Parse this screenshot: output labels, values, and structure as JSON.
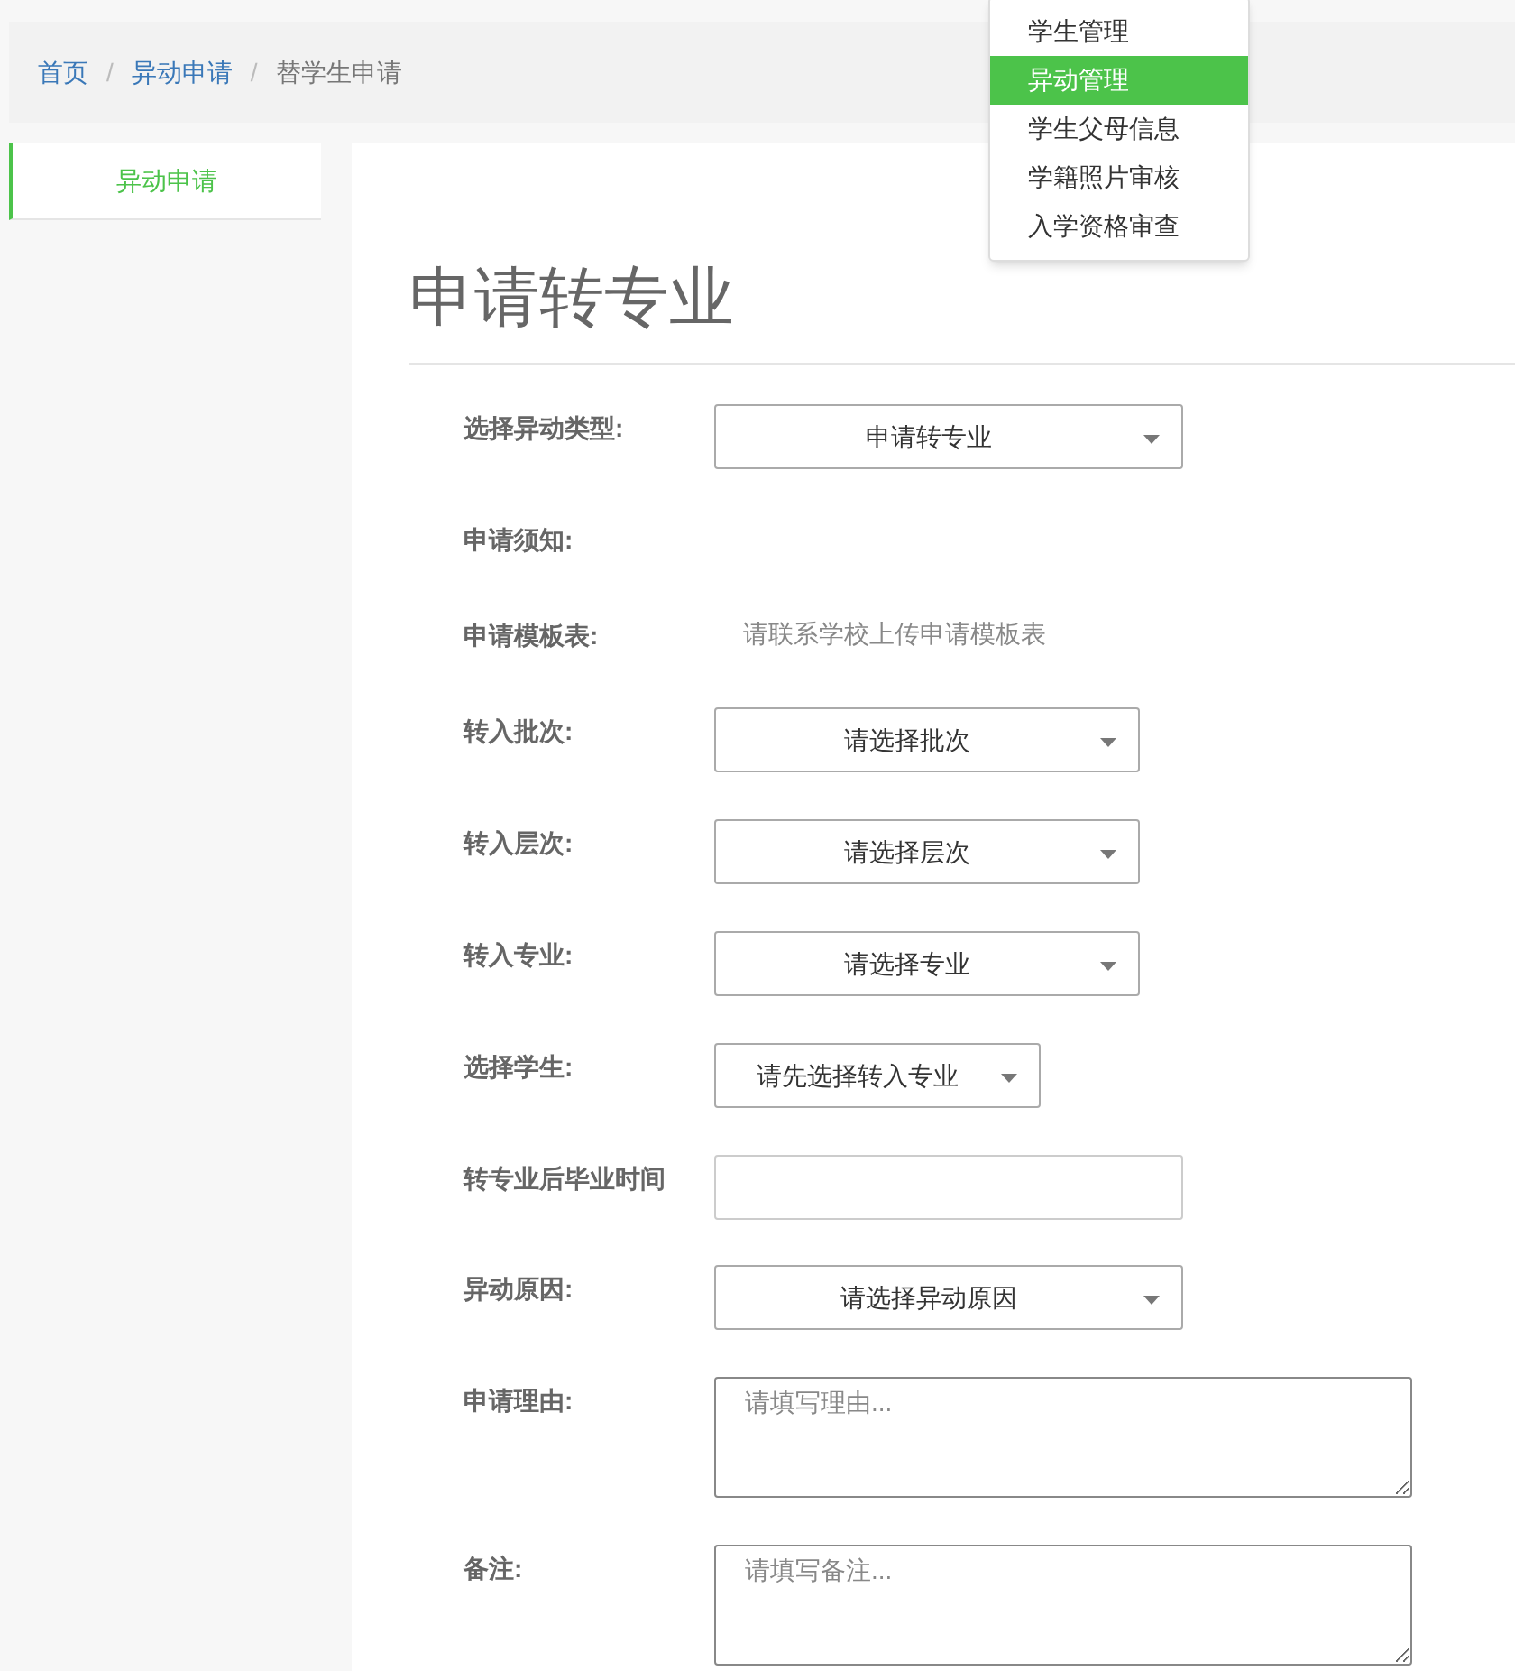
{
  "breadcrumb": [
    {
      "label": "首页",
      "link": true
    },
    {
      "label": "异动申请",
      "link": true
    },
    {
      "label": "替学生申请",
      "link": false
    }
  ],
  "breadcrumb_separator": "/",
  "sidebar": {
    "items": [
      {
        "label": "异动申请",
        "selected": true
      }
    ]
  },
  "dropdown_menu": {
    "items": [
      {
        "label": "学生管理",
        "selected": false
      },
      {
        "label": "异动管理",
        "selected": true
      },
      {
        "label": "学生父母信息",
        "selected": false
      },
      {
        "label": "学籍照片审核",
        "selected": false
      },
      {
        "label": "入学资格审查",
        "selected": false
      }
    ]
  },
  "page_title": "申请转专业",
  "form": [
    {
      "kind": "select",
      "label": "选择异动类型:",
      "value": "申请转专业"
    },
    {
      "kind": "note",
      "label": "申请须知:"
    },
    {
      "kind": "text",
      "label": "申请模板表:",
      "value": "请联系学校上传申请模板表"
    },
    {
      "kind": "select",
      "label": "转入批次:",
      "value": "请选择批次"
    },
    {
      "kind": "select",
      "label": "转入层次:",
      "value": "请选择层次"
    },
    {
      "kind": "select",
      "label": "转入专业:",
      "value": "请选择专业"
    },
    {
      "kind": "select",
      "label": "选择学生:",
      "value": "请先选择转入专业"
    },
    {
      "kind": "input",
      "label": "转专业后毕业时间"
    },
    {
      "kind": "select",
      "label": "异动原因:",
      "value": "请选择异动原因"
    },
    {
      "kind": "textarea",
      "label": "申请理由:",
      "placeholder": "请填写理由..."
    },
    {
      "kind": "textarea",
      "label": "备注:",
      "placeholder": "请填写备注..."
    }
  ]
}
